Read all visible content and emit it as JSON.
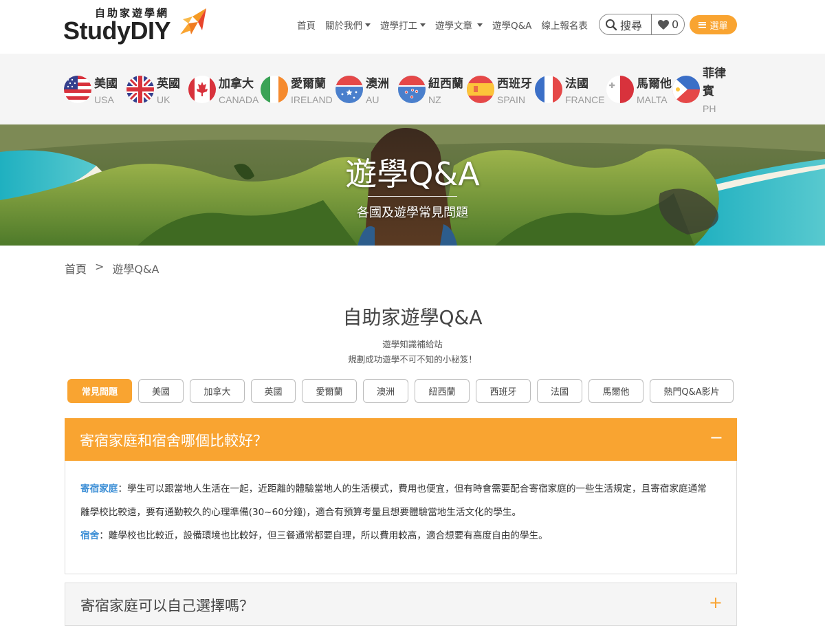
{
  "logo": {
    "cn": "自助家遊學網",
    "en_prefix": "Study",
    "en_suffix": "DIY"
  },
  "nav": {
    "items": [
      {
        "label": "首頁",
        "dropdown": false
      },
      {
        "label": "關於我們",
        "dropdown": true
      },
      {
        "label": "遊學打工",
        "dropdown": true
      },
      {
        "label": "遊學文章",
        "dropdown": true
      },
      {
        "label": "遊學Q&A",
        "dropdown": false
      },
      {
        "label": "線上報名表",
        "dropdown": false
      }
    ],
    "search_label": "搜尋",
    "favorites_count": "0",
    "menu_label": "選單"
  },
  "countries": [
    {
      "cn": "美國",
      "en": "USA",
      "flag": "usa-flag-icon"
    },
    {
      "cn": "英國",
      "en": "UK",
      "flag": "uk-flag-icon"
    },
    {
      "cn": "加拿大",
      "en": "CANADA",
      "flag": "canada-flag-icon"
    },
    {
      "cn": "愛爾蘭",
      "en": "IRELAND",
      "flag": "ireland-flag-icon"
    },
    {
      "cn": "澳洲",
      "en": "AU",
      "flag": "australia-flag-icon"
    },
    {
      "cn": "紐西蘭",
      "en": "NZ",
      "flag": "new-zealand-flag-icon"
    },
    {
      "cn": "西班牙",
      "en": "SPAIN",
      "flag": "spain-flag-icon"
    },
    {
      "cn": "法國",
      "en": "FRANCE",
      "flag": "france-flag-icon"
    },
    {
      "cn": "馬爾他",
      "en": "MALTA",
      "flag": "malta-flag-icon"
    },
    {
      "cn": "菲律賓",
      "en": "PH",
      "flag": "philippines-flag-icon"
    }
  ],
  "banner": {
    "title": "遊學Q&A",
    "subtitle": "各國及遊學常見問題"
  },
  "breadcrumb": {
    "home": "首頁",
    "sep": ">",
    "current": "遊學Q&A"
  },
  "section": {
    "title": "自助家遊學Q&A",
    "sub1": "遊學知識補給站",
    "sub2": "規劃成功遊學不可不知的小秘笈！"
  },
  "tabs": [
    {
      "label": "常見問題",
      "active": true
    },
    {
      "label": "美國",
      "active": false
    },
    {
      "label": "加拿大",
      "active": false
    },
    {
      "label": "英國",
      "active": false
    },
    {
      "label": "愛爾蘭",
      "active": false
    },
    {
      "label": "澳洲",
      "active": false
    },
    {
      "label": "紐西蘭",
      "active": false
    },
    {
      "label": "西班牙",
      "active": false
    },
    {
      "label": "法國",
      "active": false
    },
    {
      "label": "馬爾他",
      "active": false
    },
    {
      "label": "熱門Q&A影片",
      "active": false
    }
  ],
  "accordion": [
    {
      "question": "寄宿家庭和宿舍哪個比較好？",
      "toggle": "−",
      "expanded": true,
      "answers": [
        {
          "keyword": "寄宿家庭",
          "text": "：學生可以跟當地人生活在一起，近距離的體驗當地人的生活模式，費用也便宜，但有時會需要配合寄宿家庭的一些生活規定，且寄宿家庭通常離學校比較遠，要有通勤較久的心理準備(30~60分鐘)，適合有預算考量且想要體驗當地生活文化的學生。"
        },
        {
          "keyword": "宿舍",
          "text": "：離學校也比較近，設備環境也比較好，但三餐通常都要自理，所以費用較高，適合想要有高度自由的學生。"
        }
      ]
    },
    {
      "question": "寄宿家庭可以自己選擇嗎？",
      "toggle": "+",
      "expanded": false
    }
  ],
  "colors": {
    "accent": "#f9a431",
    "keyword": "#3d8fd6",
    "country_bar": "#f5f5f5"
  }
}
